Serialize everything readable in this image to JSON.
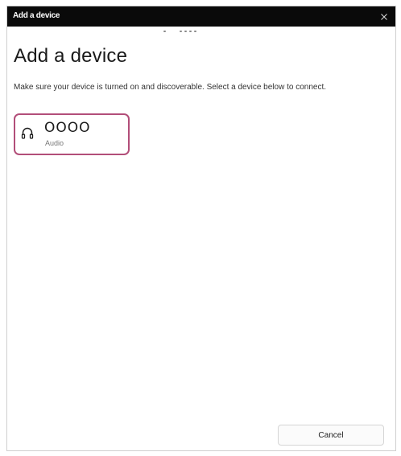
{
  "window": {
    "title": "Add a device",
    "close_icon": "close-icon"
  },
  "content": {
    "heading": "Add a device",
    "instructions": "Make sure your device is turned on and discoverable. Select a device below to connect."
  },
  "devices": [
    {
      "name": "OOOO",
      "type": "Audio",
      "icon": "headphones-icon",
      "selected": true,
      "highlight_color": "#b24e79"
    }
  ],
  "footer": {
    "cancel_label": "Cancel"
  }
}
